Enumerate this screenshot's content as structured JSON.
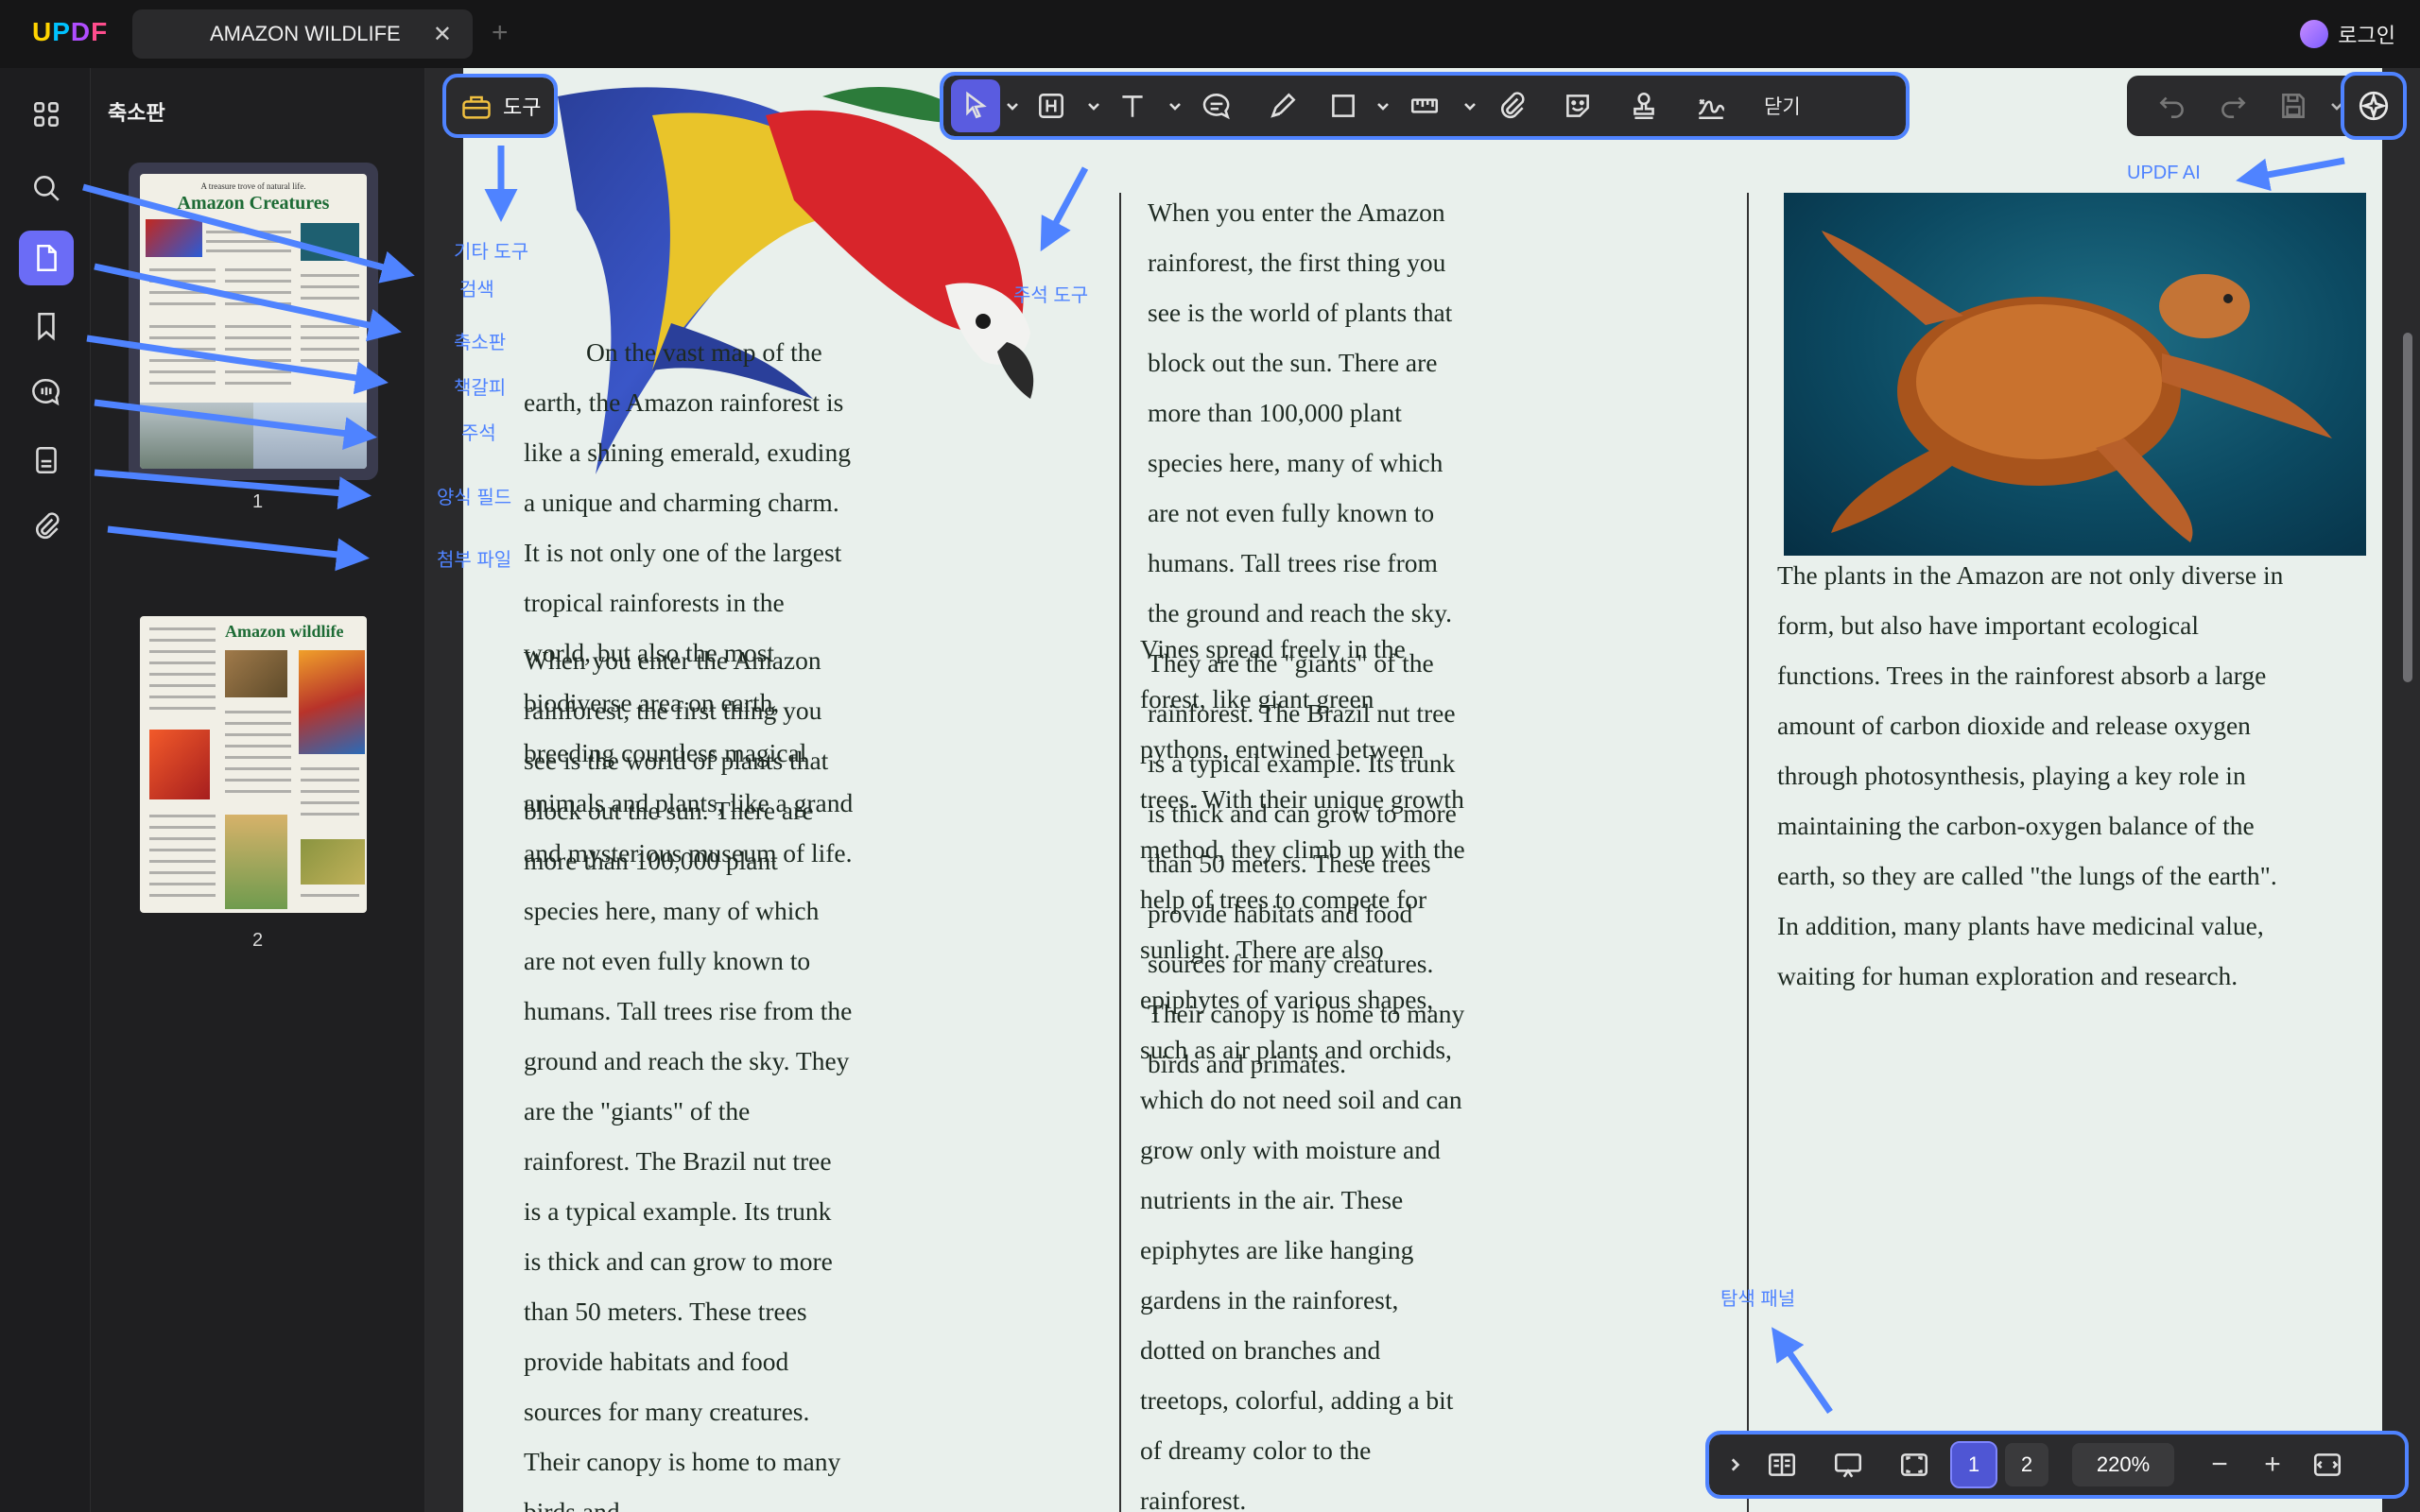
{
  "app": {
    "logo": "UPDF",
    "login_label": "로그인"
  },
  "tab": {
    "title": "AMAZON WILDLIFE",
    "close_glyph": "✕",
    "new_glyph": "+"
  },
  "thumbnails": {
    "title": "축소판",
    "pages": [
      {
        "label": "1",
        "heading_small": "A treasure trove of natural life.",
        "heading": "Amazon Creatures"
      },
      {
        "label": "2",
        "heading": "Amazon wildlife"
      }
    ]
  },
  "toolbar": {
    "tools_label": "도구",
    "close_label": "닫기"
  },
  "bottom_bar": {
    "pages": [
      "1",
      "2"
    ],
    "current_page": "1",
    "zoom": "220%",
    "minus": "−",
    "plus": "+"
  },
  "callouts": {
    "other_tools": "기타 도구",
    "search": "검색",
    "thumbnails": "축소판",
    "bookmarks": "책갈피",
    "comments": "주석",
    "form_fields": "양식 필드",
    "attachments": "첨부 파일",
    "annotation_tools": "주석 도구",
    "updf_ai": "UPDF AI",
    "nav_panel": "탐색 패널"
  },
  "document": {
    "col1_top": "On the vast map of the earth, the Amazon rainforest is like a shining emerald, exuding a unique and charming charm. It is not only one of the largest tropical rainforests in the world, but also the most biodiverse area on earth, breeding countless magical animals and plants, like a grand and mysterious museum of life.",
    "col1_bottom": "When you enter the Amazon rainforest, the first thing you see is the world of plants that block out the sun. There are more than 100,000 plant species here, many of which are not even fully known to humans. Tall trees rise from the ground and reach the sky. They are the \"giants\" of the rainforest. The Brazil nut tree is a typical example. Its trunk is thick and can grow to more than 50 meters. These trees provide habitats and food sources for many creatures. Their canopy is home to many birds and",
    "col2_top": "When you enter the Amazon rainforest, the first thing you see is the world of plants that block out the sun. There are more than 100,000 plant species here, many of which are not even fully known to humans. Tall trees rise from the ground and reach the sky. They are the \"giants\" of the rainforest. The Brazil nut tree is a typical example. Its trunk is thick and can grow to more than 50 meters. These trees provide habitats and food sources for many creatures. Their canopy is home to many birds and primates.",
    "col2_bottom": "Vines spread freely in the forest, like giant green pythons, entwined between trees. With their unique growth method, they climb up with the help of trees to compete for sunlight. There are also epiphytes of various shapes, such as air plants and orchids, which do not need soil and can grow only with moisture and nutrients in the air. These epiphytes are like hanging gardens in the rainforest, dotted on branches and treetops, colorful, adding a bit of dreamy color to the rainforest.",
    "col3": "The plants in the Amazon are not only diverse in form, but also have important ecological functions. Trees in the rainforest absorb a large amount of carbon dioxide and release oxygen through photosynthesis, playing a key role in maintaining the carbon-oxygen balance of the earth, so they are called \"the lungs of the earth\". In addition, many plants have medicinal value, waiting for human exploration and research."
  },
  "colors": {
    "accent": "#4f83ff",
    "active": "#6b6cf6",
    "page_bg": "#e9f0ec"
  }
}
